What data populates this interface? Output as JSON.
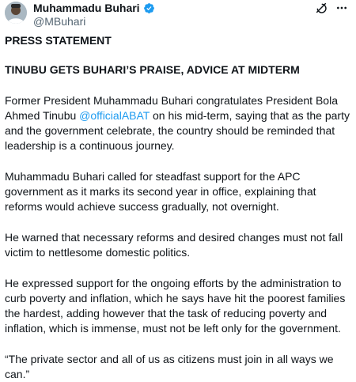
{
  "author": {
    "display_name": "Muhammadu Buhari",
    "handle": "@MBuhari",
    "verified": true
  },
  "header_icons": [
    "grok-icon",
    "more-icon"
  ],
  "tweet": {
    "press_statement": "PRESS STATEMENT",
    "headline": "TINUBU GETS BUHARI’S PRAISE, ADVICE AT MIDTERM",
    "p1_before": "Former President Muhammadu Buhari congratulates President Bola Ahmed Tinubu ",
    "p1_mention": "@officialABAT",
    "p1_after": " on his mid-term, saying that as the party and the government celebrate, the country should be reminded that leadership is a continuous journey.",
    "p2": "Muhammadu Buhari called for steadfast support for the APC government as it marks its second year in office, explaining that reforms would achieve success gradually, not overnight.",
    "p3": "He warned that necessary reforms and desired changes must not fall victim to nettlesome domestic politics.",
    "p4": "He expressed support for the ongoing efforts by the administration to curb poverty and inflation, which he says have hit the poorest families the hardest, adding however that the task of reducing poverty and inflation, which is immense, must not be left only for the government.",
    "p5": "“The private sector and all of us as citizens must join in all ways we can.”"
  },
  "colors": {
    "text": "#0f1419",
    "secondary": "#536471",
    "link": "#1d9bf0",
    "verified": "#1d9bf0"
  }
}
